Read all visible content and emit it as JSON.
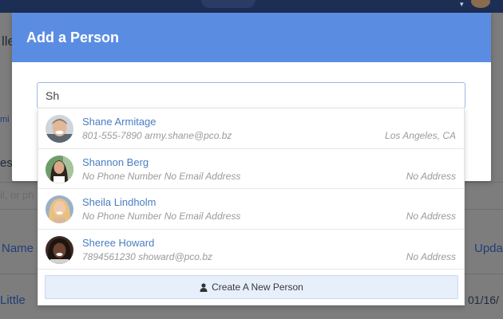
{
  "background": {
    "fragments": {
      "heading_fragment": "lle",
      "sidebar_fragment_1": "mi",
      "sidebar_fragment_2": "es",
      "placeholder_fragment": "il, or ph",
      "column_name": "Name",
      "column_updated": "Upda",
      "row_name": "Little",
      "row_date": "01/16/"
    }
  },
  "modal": {
    "title": "Add a Person",
    "search": {
      "value": "Sh",
      "placeholder": ""
    },
    "results": [
      {
        "name": "Shane Armitage",
        "phone": "801-555-7890",
        "email": "army.shane@pco.bz",
        "location": "Los Angeles, CA",
        "avatar_icon": "avatar-shane-armitage"
      },
      {
        "name": "Shannon Berg",
        "phone": "No Phone Number",
        "email": "No Email Address",
        "location": "No Address",
        "avatar_icon": "avatar-shannon-berg"
      },
      {
        "name": "Sheila Lindholm",
        "phone": "No Phone Number",
        "email": "No Email Address",
        "location": "No Address",
        "avatar_icon": "avatar-sheila-lindholm"
      },
      {
        "name": "Sheree Howard",
        "phone": "7894561230",
        "email": "showard@pco.bz",
        "location": "No Address",
        "avatar_icon": "avatar-sheree-howard"
      }
    ],
    "create_button": {
      "label": "Create A New Person",
      "icon": "person-icon"
    }
  },
  "colors": {
    "header": "#5a8de2",
    "link": "#4a7dc2",
    "muted_text": "#9a9a9a",
    "create_button_bg": "#e7effb"
  }
}
